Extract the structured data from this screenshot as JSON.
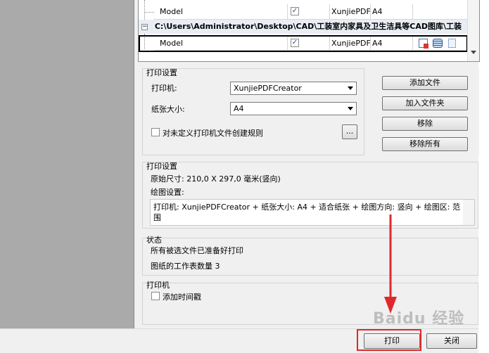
{
  "grid": {
    "rows": [
      {
        "name": "Model",
        "printer": "XunjiePDF",
        "size": "A4"
      },
      {
        "name": "Model",
        "printer": "XunjiePDF",
        "size": "A4"
      }
    ],
    "group_path": "C:\\Users\\Administrator\\Desktop\\CAD\\工装室内家具及卫生洁具等CAD图库\\工装"
  },
  "print_settings": {
    "title": "打印设置",
    "printer_label": "打印机:",
    "printer_value": "XunjiePDFCreator",
    "paper_label": "纸张大小:",
    "paper_value": "A4",
    "rule_label": "对未定义打印机文件创建规则",
    "ellipsis": "..."
  },
  "file_buttons": {
    "add_file": "添加文件",
    "add_folder": "加入文件夹",
    "remove": "移除",
    "remove_all": "移除所有"
  },
  "plot_settings": {
    "title": "打印设置",
    "original_size": "原始尺寸: 210,0 X 297,0 毫米(竖向)",
    "draw_label": "绘图设置:",
    "draw_text": "打印机: XunjiePDFCreator + 纸张大小: A4 + 适合纸张 + 绘图方向: 竖向 + 绘图区: 范围"
  },
  "status": {
    "title": "状态",
    "line1": "所有被选文件已准备好打印",
    "line2": "图纸的工作表数量 3"
  },
  "printer_panel": {
    "title": "打印机",
    "timestamp_label": "添加时间戳"
  },
  "footer": {
    "print_label": "打印",
    "close_label": "关闭"
  },
  "watermark": "Baidu 经验",
  "colors": {
    "highlight": "#e0282a",
    "left_pane": "#aaaaaa"
  }
}
